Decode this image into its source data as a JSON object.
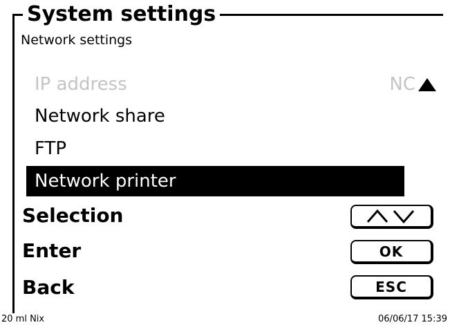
{
  "header": {
    "title": "System settings",
    "subtitle": "Network settings"
  },
  "menu": {
    "items": [
      {
        "label": "IP address",
        "state": "disabled",
        "value": "NC"
      },
      {
        "label": "Network share",
        "state": "normal"
      },
      {
        "label": "FTP",
        "state": "normal"
      },
      {
        "label": "Network printer",
        "state": "selected"
      }
    ]
  },
  "keys": [
    {
      "label": "Selection",
      "button": "",
      "button_icon": "up-down-arrows-icon"
    },
    {
      "label": "Enter",
      "button": "OK"
    },
    {
      "label": "Back",
      "button": "ESC"
    }
  ],
  "status": {
    "left": "20 ml Nix",
    "right": "06/06/17 15:39"
  },
  "colors": {
    "disabled": "#c4c4c4",
    "selected_bg": "#000000",
    "selected_fg": "#ffffff"
  }
}
